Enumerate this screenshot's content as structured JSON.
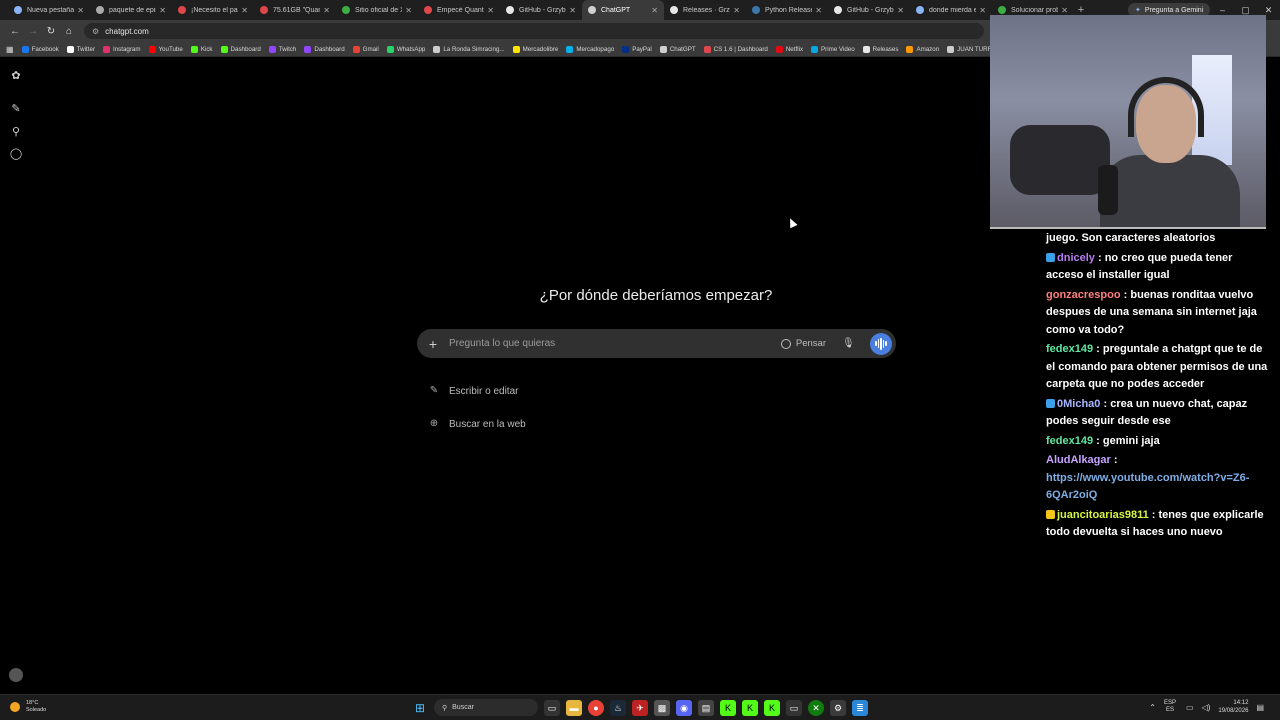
{
  "browser": {
    "tabs": [
      {
        "title": "Nueva pestaña",
        "color": "#8ab4f8",
        "active": false
      },
      {
        "title": "paquete de episo",
        "color": "#aaaaaa",
        "active": false
      },
      {
        "title": "¡Necesito el paq",
        "color": "#e0474c",
        "active": false
      },
      {
        "title": "75.61GB \"Quanti",
        "color": "#e0474c",
        "active": false
      },
      {
        "title": "Sitio oficial de Xb",
        "color": "#3cb043",
        "active": false
      },
      {
        "title": "Empecé Quantum",
        "color": "#e0474c",
        "active": false
      },
      {
        "title": "GitHub - GrzybD",
        "color": "#e6e6e6",
        "active": false
      },
      {
        "title": "ChatGPT",
        "color": "#cfcfcf",
        "active": true
      },
      {
        "title": "Releases · Grzyb",
        "color": "#e6e6e6",
        "active": false
      },
      {
        "title": "Python Release P",
        "color": "#3b77a8",
        "active": false
      },
      {
        "title": "GitHub - GrzybD",
        "color": "#e6e6e6",
        "active": false
      },
      {
        "title": "donde mierda es",
        "color": "#8ab4f8",
        "active": false
      },
      {
        "title": "Solucionar probl",
        "color": "#3cb043",
        "active": false
      }
    ],
    "new_tab_glyph": "+",
    "gemini_button": "Pregunta a Gemini",
    "url": "chatgpt.com",
    "bookmarks": [
      {
        "label": "Facebook",
        "color": "#1877f2"
      },
      {
        "label": "Twitter",
        "color": "#ffffff"
      },
      {
        "label": "Instagram",
        "color": "#e1306c"
      },
      {
        "label": "YouTube",
        "color": "#ff0000"
      },
      {
        "label": "Kick",
        "color": "#53fc18"
      },
      {
        "label": "Dashboard",
        "color": "#53fc18"
      },
      {
        "label": "Twitch",
        "color": "#9146ff"
      },
      {
        "label": "Dashboard",
        "color": "#9146ff"
      },
      {
        "label": "Gmail",
        "color": "#ea4335"
      },
      {
        "label": "WhatsApp",
        "color": "#25d366"
      },
      {
        "label": "La Ronda Simracing...",
        "color": "#cccccc"
      },
      {
        "label": "Mercadolibre",
        "color": "#ffe600"
      },
      {
        "label": "Mercadopago",
        "color": "#00b1ea"
      },
      {
        "label": "PayPal",
        "color": "#003087"
      },
      {
        "label": "ChatGPT",
        "color": "#cfcfcf"
      },
      {
        "label": "CS 1.6 | Dashboard",
        "color": "#e0474c"
      },
      {
        "label": "Netflix",
        "color": "#e50914"
      },
      {
        "label": "Prime Video",
        "color": "#00a8e1"
      },
      {
        "label": "Releases",
        "color": "#e6e6e6"
      },
      {
        "label": "Amazon",
        "color": "#ff9900"
      },
      {
        "label": "JUAN TURR",
        "color": "#cccccc"
      }
    ]
  },
  "chatgpt": {
    "headline": "¿Por dónde deberíamos empezar?",
    "prompt_placeholder": "Pregunta lo que quieras",
    "think_label": "Pensar",
    "suggestions": [
      {
        "label": "Escribir o editar",
        "icon": "pencil-icon"
      },
      {
        "label": "Buscar en la web",
        "icon": "globe-icon"
      }
    ]
  },
  "chat": {
    "messages": [
      {
        "user": "",
        "user_color": "#ffffff",
        "text": "juego. Son caracteres aleatorios",
        "badge": ""
      },
      {
        "user": "dnicely",
        "user_color": "#b77cf2",
        "text": ": no creo que pueda tener acceso el installer igual",
        "badge": "#3aa0e8"
      },
      {
        "user": "gonzacrespoo",
        "user_color": "#ff7f7f",
        "text": ": buenas ronditaa vuelvo despues de una semana sin internet jaja como va todo?",
        "badge": ""
      },
      {
        "user": "fedex149",
        "user_color": "#5ee6a0",
        "text": ": preguntale a chatgpt que te de el comando para obtener permisos de una carpeta que no podes acceder",
        "badge": ""
      },
      {
        "user": "0Micha0",
        "user_color": "#a7b6ff",
        "text": ": crea un nuevo chat, capaz podes seguir desde ese",
        "badge": "#3aa0e8"
      },
      {
        "user": "fedex149",
        "user_color": "#5ee6a0",
        "text": ": gemini jaja",
        "badge": ""
      },
      {
        "user": "AludAlkagar",
        "user_color": "#c7a3ff",
        "text": ":",
        "link": "https://www.youtube.com/watch?v=Z6-6QAr2oiQ",
        "badge": ""
      },
      {
        "user": "juancitoarias9811",
        "user_color": "#d6f542",
        "text": ": tenes que explicarle todo devuelta si haces uno nuevo",
        "badge": "#f5c518"
      }
    ]
  },
  "taskbar": {
    "weather_temp": "18°C",
    "weather_desc": "Soleado",
    "search_label": "Buscar",
    "lang_top": "ESP",
    "lang_bottom": "ES",
    "time": "14:12",
    "date": "19/08/2026"
  }
}
